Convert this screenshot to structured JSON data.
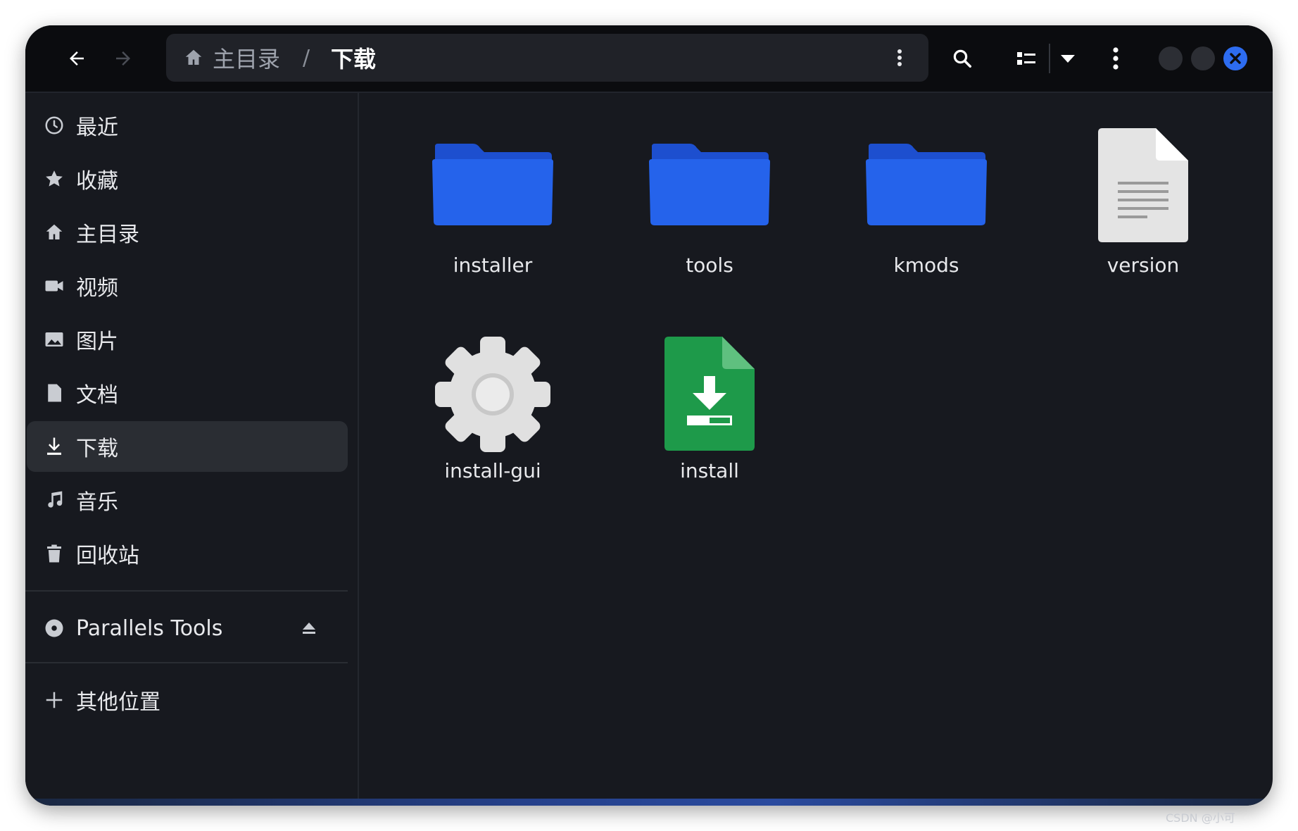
{
  "headerbar": {
    "back_icon": "arrow-left-icon",
    "forward_icon": "arrow-right-icon",
    "path": {
      "home_label": "主目录",
      "separator": "/",
      "current_label": "下载"
    },
    "icons": [
      "search-icon",
      "view-list-icon",
      "dropdown-icon",
      "menu-icon"
    ]
  },
  "sidebar": {
    "items": [
      {
        "label": "最近",
        "icon": "clock-icon"
      },
      {
        "label": "收藏",
        "icon": "star-icon"
      },
      {
        "label": "主目录",
        "icon": "home-icon"
      },
      {
        "label": "视频",
        "icon": "video-icon"
      },
      {
        "label": "图片",
        "icon": "image-icon"
      },
      {
        "label": "文档",
        "icon": "document-icon"
      },
      {
        "label": "下载",
        "icon": "download-icon",
        "active": true
      },
      {
        "label": "音乐",
        "icon": "music-icon"
      },
      {
        "label": "回收站",
        "icon": "trash-icon"
      }
    ],
    "device": {
      "label": "Parallels Tools",
      "icon": "disc-icon",
      "eject_icon": "eject-icon"
    },
    "other": {
      "label": "其他位置",
      "icon": "plus-icon"
    }
  },
  "files": [
    {
      "name": "installer",
      "type": "folder"
    },
    {
      "name": "tools",
      "type": "folder"
    },
    {
      "name": "kmods",
      "type": "folder"
    },
    {
      "name": "version",
      "type": "text-file"
    },
    {
      "name": "install-gui",
      "type": "executable"
    },
    {
      "name": "install",
      "type": "installer-package"
    }
  ],
  "colors": {
    "accent": "#2d6cf0",
    "folder": "#2563eb",
    "window_bg": "#17191f",
    "header_bg": "#0b0c0f",
    "installer_green": "#1e9a4a"
  },
  "watermark": "CSDN @小可"
}
